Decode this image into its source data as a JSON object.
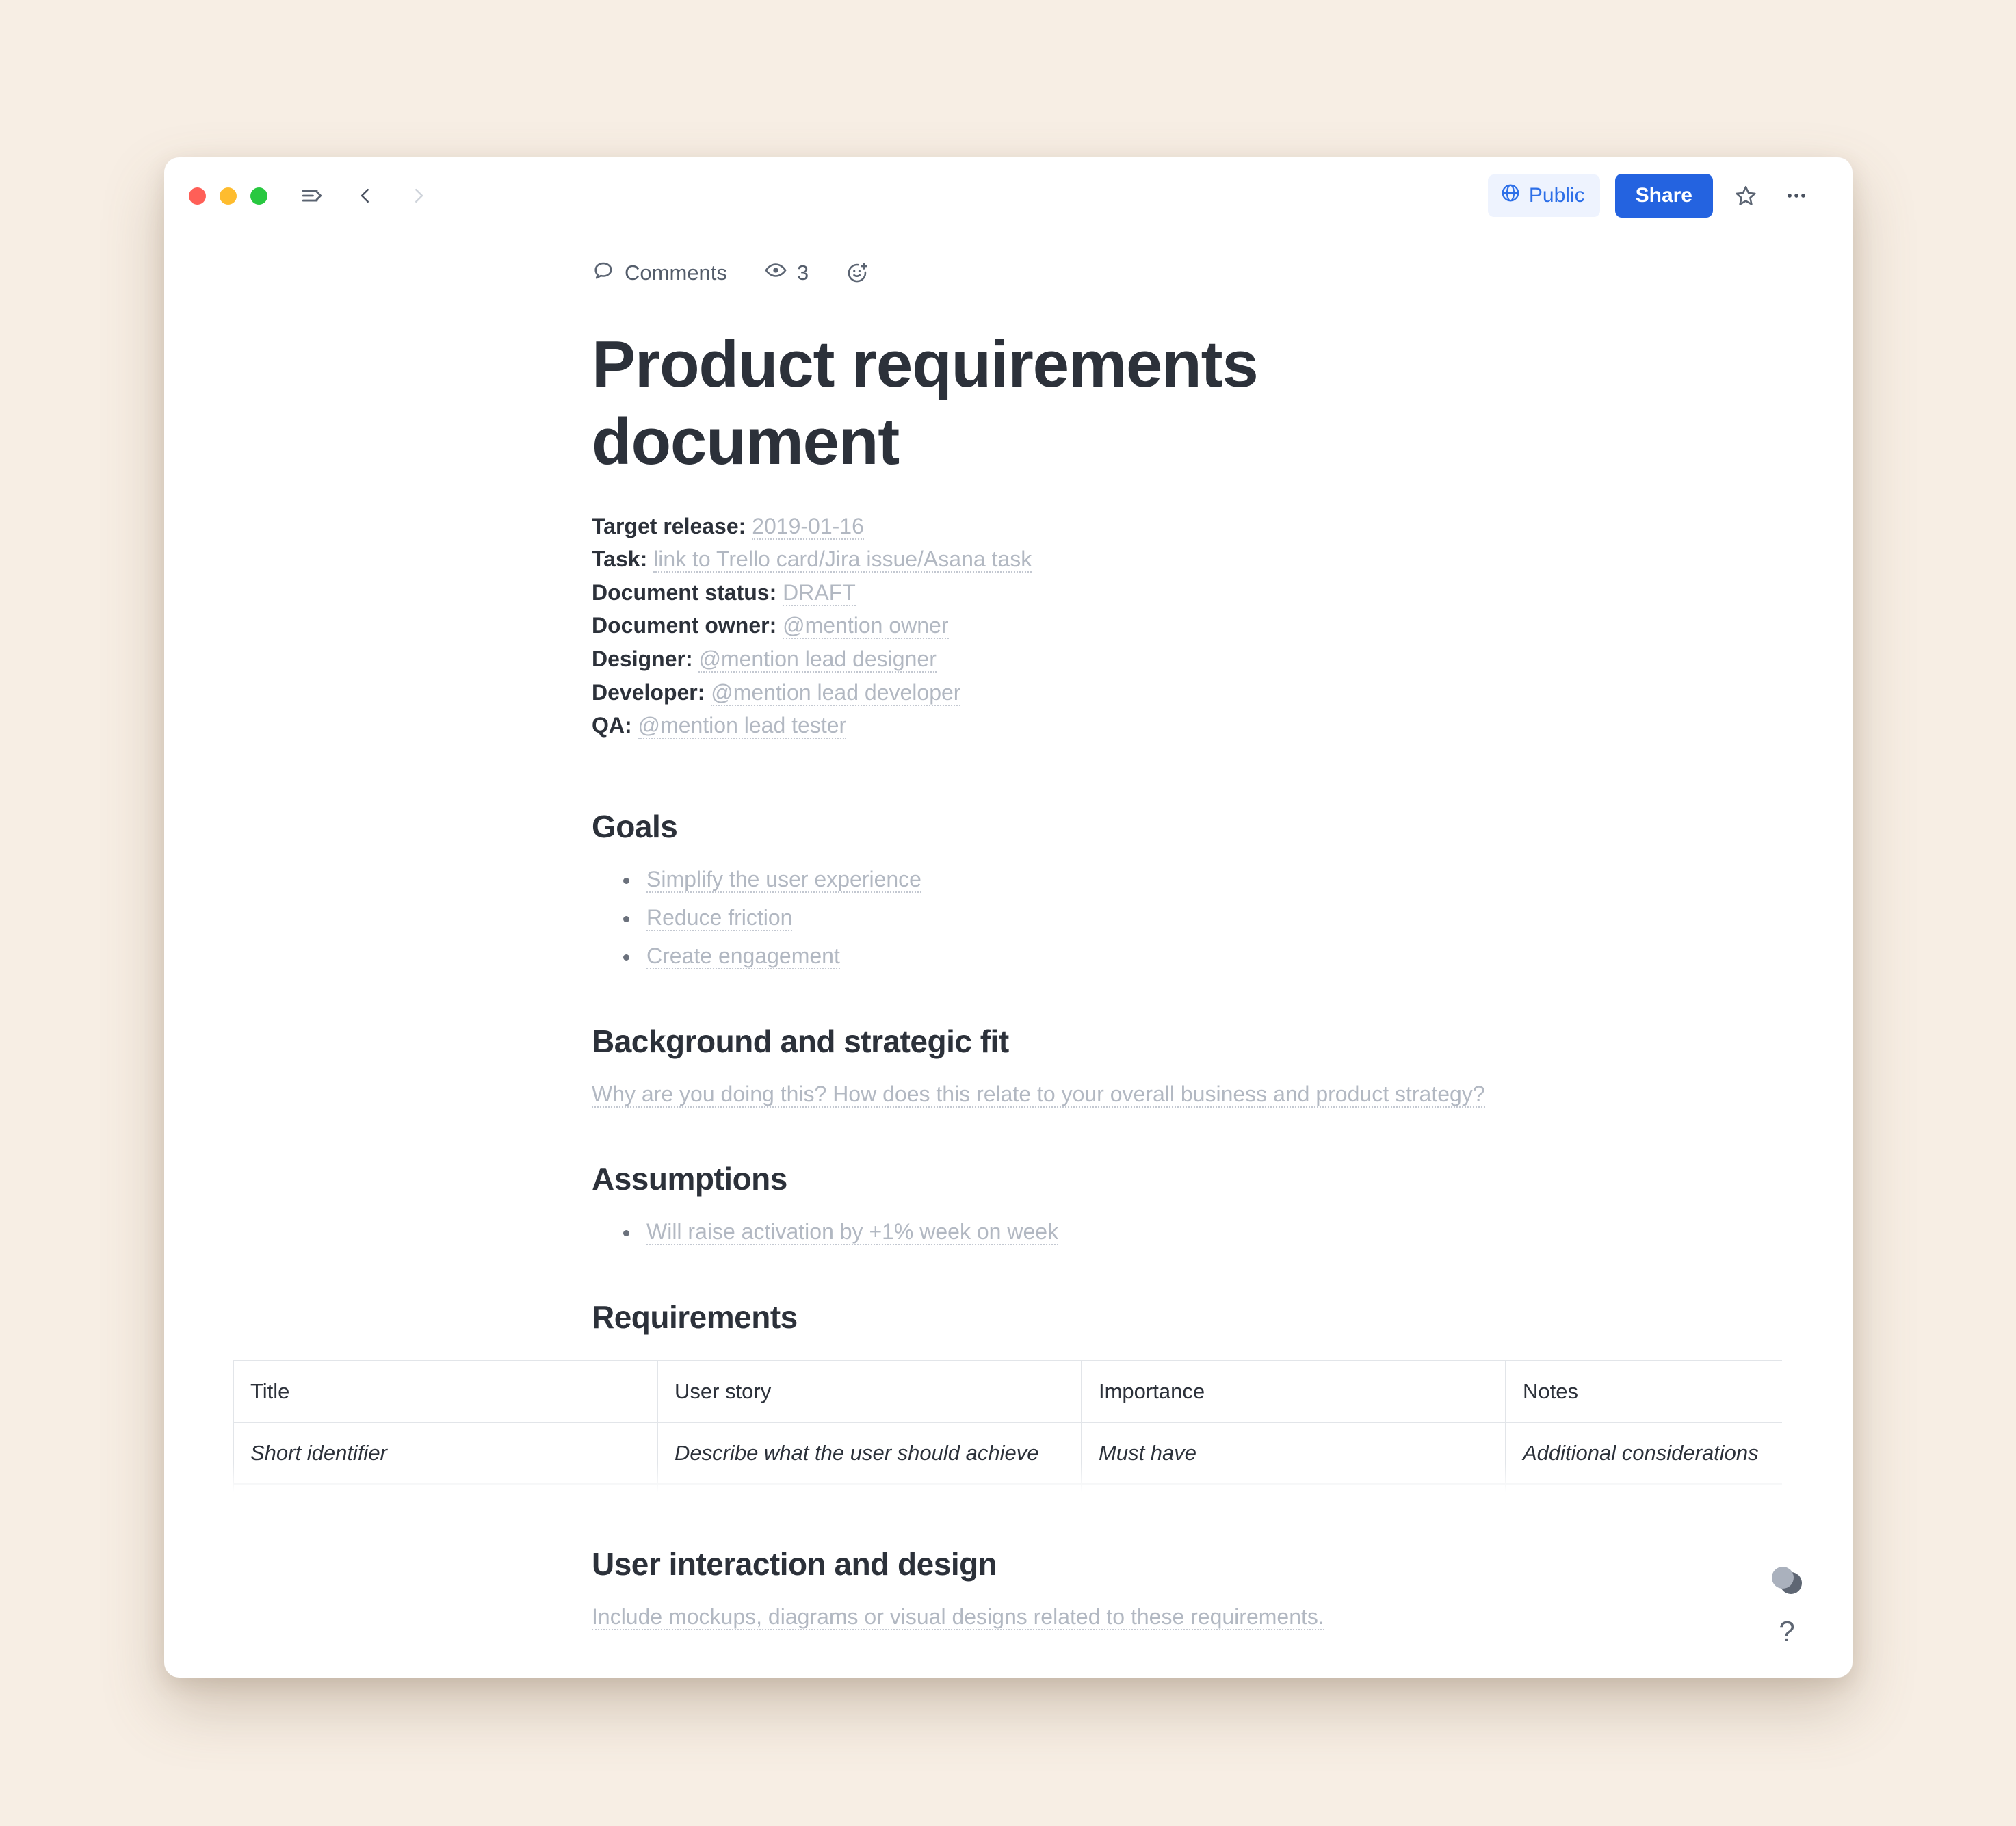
{
  "window": {
    "traffic_lights": [
      "close",
      "minimize",
      "maximize"
    ],
    "sidebar_toggle_icon": "sidebar-toggle-icon",
    "back_icon": "chevron-left-icon",
    "forward_icon": "chevron-right-icon",
    "public_label": "Public",
    "share_label": "Share",
    "star_icon": "star-outline-icon",
    "more_icon": "ellipsis-icon",
    "accent_blue": "#2463e0",
    "chip_bg": "#eef3fe",
    "chip_text": "#2d6fe8"
  },
  "meta_bar": {
    "comments_label": "Comments",
    "comments_icon": "speech-bubble-icon",
    "views_icon": "eye-icon",
    "views_count": "3",
    "reaction_icon": "add-reaction-icon"
  },
  "document": {
    "title": "Product requirements document",
    "fields": [
      {
        "label": "Target release:",
        "value": "2019-01-16"
      },
      {
        "label": "Task:",
        "value": "link to Trello card/Jira issue/Asana task"
      },
      {
        "label": "Document status:",
        "value": "DRAFT"
      },
      {
        "label": "Document owner:",
        "value": "@mention owner"
      },
      {
        "label": "Designer:",
        "value": "@mention lead designer"
      },
      {
        "label": "Developer:",
        "value": "@mention lead developer"
      },
      {
        "label": "QA:",
        "value": "@mention lead tester"
      }
    ],
    "sections": {
      "goals": {
        "heading": "Goals",
        "items": [
          "Simplify the user experience",
          "Reduce friction",
          "Create engagement"
        ]
      },
      "background": {
        "heading": "Background and strategic fit",
        "body": "Why are you doing this? How does this relate to your overall business and product strategy?"
      },
      "assumptions": {
        "heading": "Assumptions",
        "items": [
          "Will raise activation by +1% week on week"
        ]
      },
      "requirements": {
        "heading": "Requirements",
        "columns": [
          "Title",
          "User story",
          "Importance",
          "Notes"
        ],
        "rows": [
          [
            "Short identifier",
            "Describe what the user should achieve",
            "Must have",
            "Additional considerations"
          ],
          [
            "",
            "",
            "",
            ""
          ]
        ]
      },
      "user_interaction": {
        "heading": "User interaction and design",
        "body": "Include mockups, diagrams or visual designs related to these requirements."
      }
    }
  },
  "float_tools": {
    "presence_icon": "presence-avatars-icon",
    "help_label": "?"
  }
}
